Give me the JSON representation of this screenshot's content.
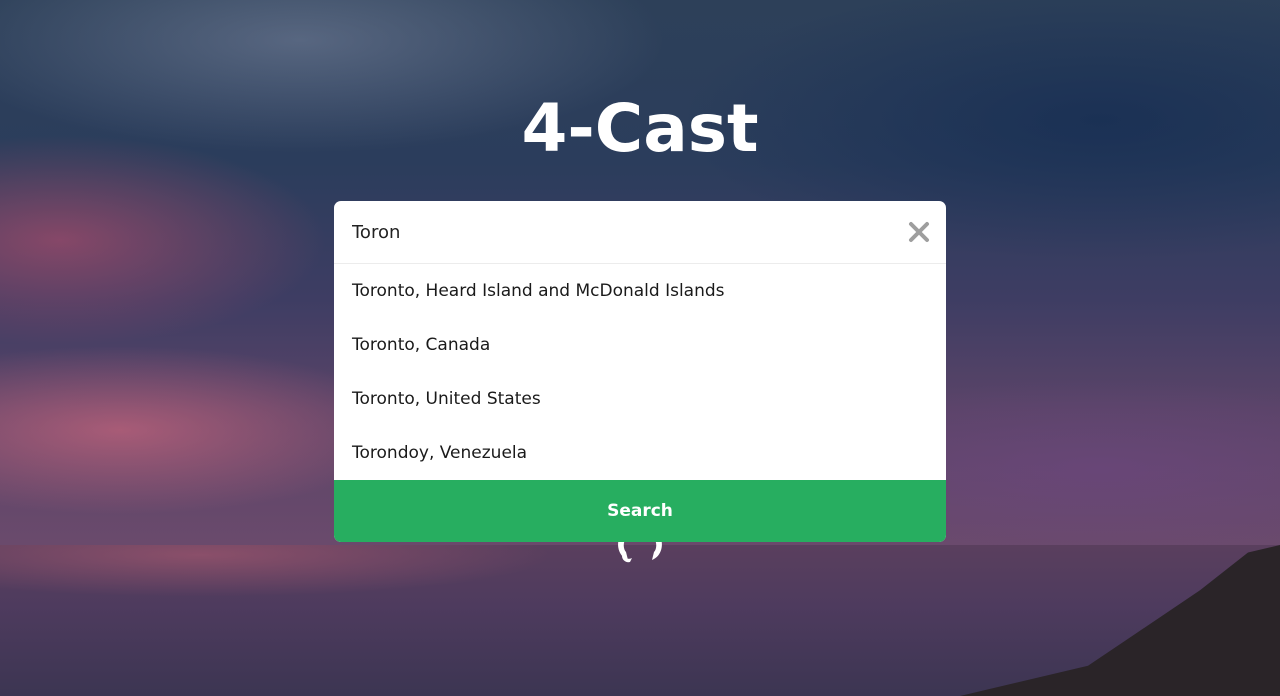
{
  "app": {
    "title": "4-Cast"
  },
  "search": {
    "value": "Toron",
    "suggestions": [
      "Toronto, Heard Island and McDonald Islands",
      "Toronto, Canada",
      "Toronto, United States",
      "Torondoy, Venezuela"
    ],
    "button_label": "Search",
    "clear_icon": "close-icon"
  },
  "footer": {
    "icon": "github-icon"
  },
  "colors": {
    "accent": "#27ae60",
    "text_primary": "#ffffff",
    "clear_icon": "#9e9e9e"
  }
}
